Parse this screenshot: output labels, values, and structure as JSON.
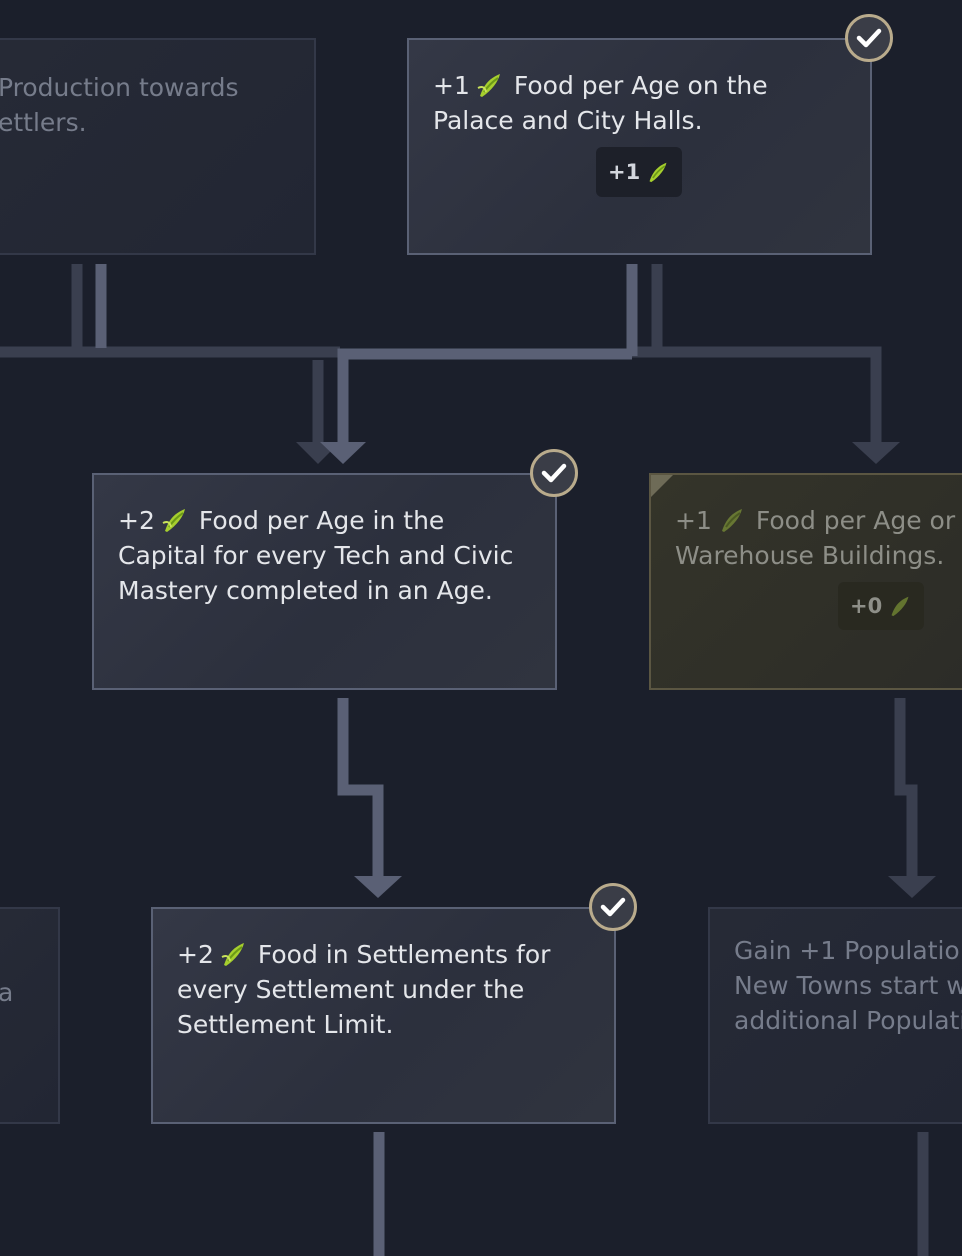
{
  "colors": {
    "background": "#1b1f2b",
    "line_bright": "#5a6075",
    "line_dim": "#3a3f4f",
    "check_ring": "#b9ab8c",
    "food_icon": "#a6cf2e"
  },
  "icons": {
    "food": "corn-food-icon",
    "completed": "checkmark-icon"
  },
  "cards": {
    "production": {
      "text": "Production towards",
      "text2": "ettlers."
    },
    "palace_food": {
      "amount": "+1",
      "text_line1": "Food per Age on the",
      "text_line2": "Palace and City Halls.",
      "badge": "+1",
      "completed": true
    },
    "capital_food": {
      "amount": "+2",
      "text_line1": "Food per Age in the",
      "text_line2": "Capital for every Tech and Civic",
      "text_line3": "Mastery completed in an Age.",
      "completed": true
    },
    "warehouse_food": {
      "amount": "+1",
      "text_line1": "Food per Age or",
      "text_line2": "Warehouse Buildings.",
      "badge": "+0",
      "completed": false
    },
    "left_partial": {
      "text": "a"
    },
    "settlement_food": {
      "amount": "+2",
      "text_line1": "Food in Settlements for",
      "text_line2": "every Settlement under the",
      "text_line3": "Settlement Limit.",
      "completed": true
    },
    "population": {
      "text_line1": "Gain +1 Populatio",
      "text_line2": "New Towns start w",
      "text_line3": "additional Populati"
    }
  }
}
